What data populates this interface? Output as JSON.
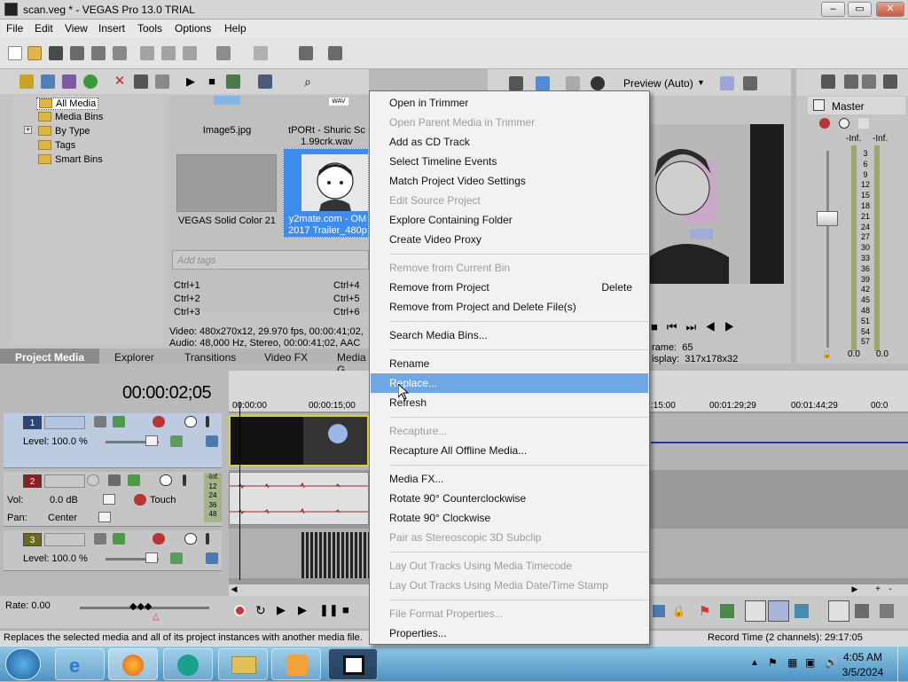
{
  "window": {
    "title": "scan.veg * - VEGAS Pro 13.0 TRIAL",
    "min": "–",
    "max": "▭",
    "close": "✕"
  },
  "menu": [
    "File",
    "Edit",
    "View",
    "Insert",
    "Tools",
    "Options",
    "Help"
  ],
  "media_tree": [
    "All Media",
    "Media Bins",
    "By Type",
    "Tags",
    "Smart Bins"
  ],
  "media_tree_expander": "+",
  "thumbnails": {
    "image5": "Image5.jpg",
    "wav_badge": "WAV",
    "wav_name_1": "tPORt - Shuric Sc",
    "wav_name_2": "1.99crk.wav",
    "solid": "VEGAS Solid Color 21",
    "video_1": "y2mate.com - OM",
    "video_2": "2017 Trailer_480p"
  },
  "tags": {
    "placeholder": "Add tags",
    "shortcuts": [
      "Ctrl+1",
      "Ctrl+2",
      "Ctrl+3",
      "Ctrl+4",
      "Ctrl+5",
      "Ctrl+6"
    ]
  },
  "media_info": {
    "video": "Video: 480x270x12, 29.970 fps, 00:00:41;02,",
    "audio": "Audio: 48,000 Hz, Stereo, 00:00:41;02, AAC"
  },
  "window_tabs": [
    "Project Media",
    "Explorer",
    "Transitions",
    "Video FX",
    "Media G"
  ],
  "preview": {
    "mode": "Preview (Auto)",
    "frame": "rame:  65",
    "display": "isplay:  317x178x32"
  },
  "master": {
    "label": "Master",
    "inf_left": "-Inf.",
    "inf_right": "-Inf.",
    "scale": [
      "3",
      "6",
      "9",
      "12",
      "15",
      "18",
      "21",
      "24",
      "27",
      "30",
      "33",
      "36",
      "39",
      "42",
      "45",
      "48",
      "51",
      "54",
      "57"
    ],
    "val_left": "0.0",
    "val_right": "0.0"
  },
  "context_menu": [
    {
      "label": "Open in Trimmer",
      "state": "enabled"
    },
    {
      "label": "Open Parent Media in Trimmer",
      "state": "disabled"
    },
    {
      "label": "Add as CD Track",
      "state": "enabled"
    },
    {
      "label": "Select Timeline Events",
      "state": "enabled"
    },
    {
      "label": "Match Project Video Settings",
      "state": "enabled"
    },
    {
      "label": "Edit Source Project",
      "state": "disabled"
    },
    {
      "label": "Explore Containing Folder",
      "state": "enabled"
    },
    {
      "label": "Create Video Proxy",
      "state": "enabled"
    },
    {
      "sep": true
    },
    {
      "label": "Remove from Current Bin",
      "state": "disabled"
    },
    {
      "label": "Remove from Project",
      "state": "enabled",
      "shortcut": "Delete"
    },
    {
      "label": "Remove from Project and Delete File(s)",
      "state": "enabled"
    },
    {
      "sep": true
    },
    {
      "label": "Search Media Bins...",
      "state": "enabled"
    },
    {
      "sep": true
    },
    {
      "label": "Rename",
      "state": "enabled"
    },
    {
      "label": "Replace...",
      "state": "highlighted"
    },
    {
      "label": "Refresh",
      "state": "enabled"
    },
    {
      "sep": true
    },
    {
      "label": "Recapture...",
      "state": "disabled"
    },
    {
      "label": "Recapture All Offline Media...",
      "state": "enabled"
    },
    {
      "sep": true
    },
    {
      "label": "Media FX...",
      "state": "enabled"
    },
    {
      "label": "Rotate 90° Counterclockwise",
      "state": "enabled"
    },
    {
      "label": "Rotate 90° Clockwise",
      "state": "enabled"
    },
    {
      "label": "Pair as Stereoscopic 3D Subclip",
      "state": "disabled"
    },
    {
      "sep": true
    },
    {
      "label": "Lay Out Tracks Using Media Timecode",
      "state": "disabled"
    },
    {
      "label": "Lay Out Tracks Using Media Date/Time Stamp",
      "state": "disabled"
    },
    {
      "sep": true
    },
    {
      "label": "File Format Properties...",
      "state": "disabled"
    },
    {
      "label": "Properties...",
      "state": "enabled"
    }
  ],
  "timeline": {
    "timecode": "00:00:02;05",
    "ruler": [
      "00:00:00",
      "00:00:15;00",
      ":15:00",
      "00:01:29;29",
      "00:01:44;29",
      "00:0"
    ],
    "track1": {
      "num": "1",
      "level": "Level: 100.0 %"
    },
    "track2": {
      "num": "2",
      "vol_label": "Vol:",
      "vol": "0.0 dB",
      "pan_label": "Pan:",
      "pan": "Center",
      "touch": "Touch",
      "meter": [
        "-Inf.",
        "12",
        "24",
        "36",
        "48"
      ]
    },
    "track3": {
      "num": "3",
      "level": "Level: 100.0 %"
    },
    "rate": "Rate: 0.00"
  },
  "status": {
    "hint": "Replaces the selected media and all of its project instances with another media file.",
    "record_time": "Record Time (2 channels): 29:17:05"
  },
  "taskbar": {
    "time": "4:05 AM",
    "date": "3/5/2024"
  },
  "colors": {
    "highlight": "#6fa6e4",
    "track1": "#29457a",
    "track2": "#8a1f1f",
    "track3": "#6a6a1c",
    "selection": "#3f8cf0"
  }
}
